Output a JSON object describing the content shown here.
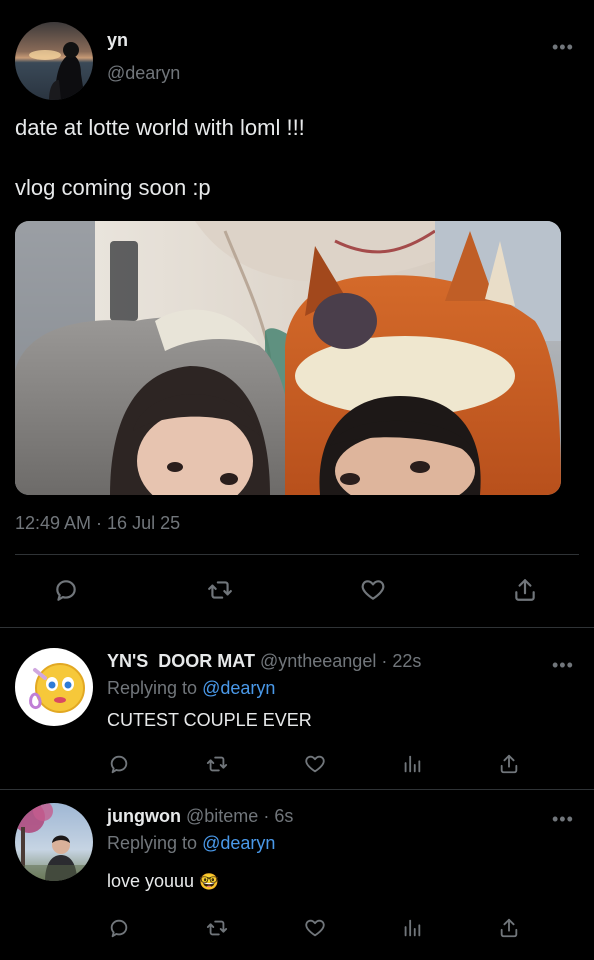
{
  "main_tweet": {
    "display_name": "yn",
    "handle": "@dearyn",
    "text_line1": "date at lotte world with loml !!!",
    "text_line2": "vlog coming soon :p",
    "timestamp": "12:49 AM · 16 Jul 25",
    "more_glyph": "•••",
    "photo_alt": "selfie of a couple wearing animal hats"
  },
  "replies": [
    {
      "display_name": "YN'S  DOOR MAT",
      "handle": "@yntheeangel",
      "sep": "·",
      "time": "22s",
      "replying_prefix": "Replying to",
      "replying_to": "@dearyn",
      "text": "CUTEST COUPLE EVER",
      "more_glyph": "•••"
    },
    {
      "display_name": "jungwon",
      "handle": "@biteme",
      "sep": "·",
      "time": "6s",
      "replying_prefix": "Replying to",
      "replying_to": "@dearyn",
      "text": "love youuu",
      "emoji": "🤓",
      "more_glyph": "•••"
    }
  ],
  "icons": {
    "reply": "reply-icon",
    "retweet": "retweet-icon",
    "like": "heart-icon",
    "analytics": "analytics-icon",
    "share": "share-icon"
  },
  "colors": {
    "background": "#000000",
    "text": "#e7e9ea",
    "muted": "#71767b",
    "link": "#4a99e9",
    "divider": "#2f3336"
  }
}
